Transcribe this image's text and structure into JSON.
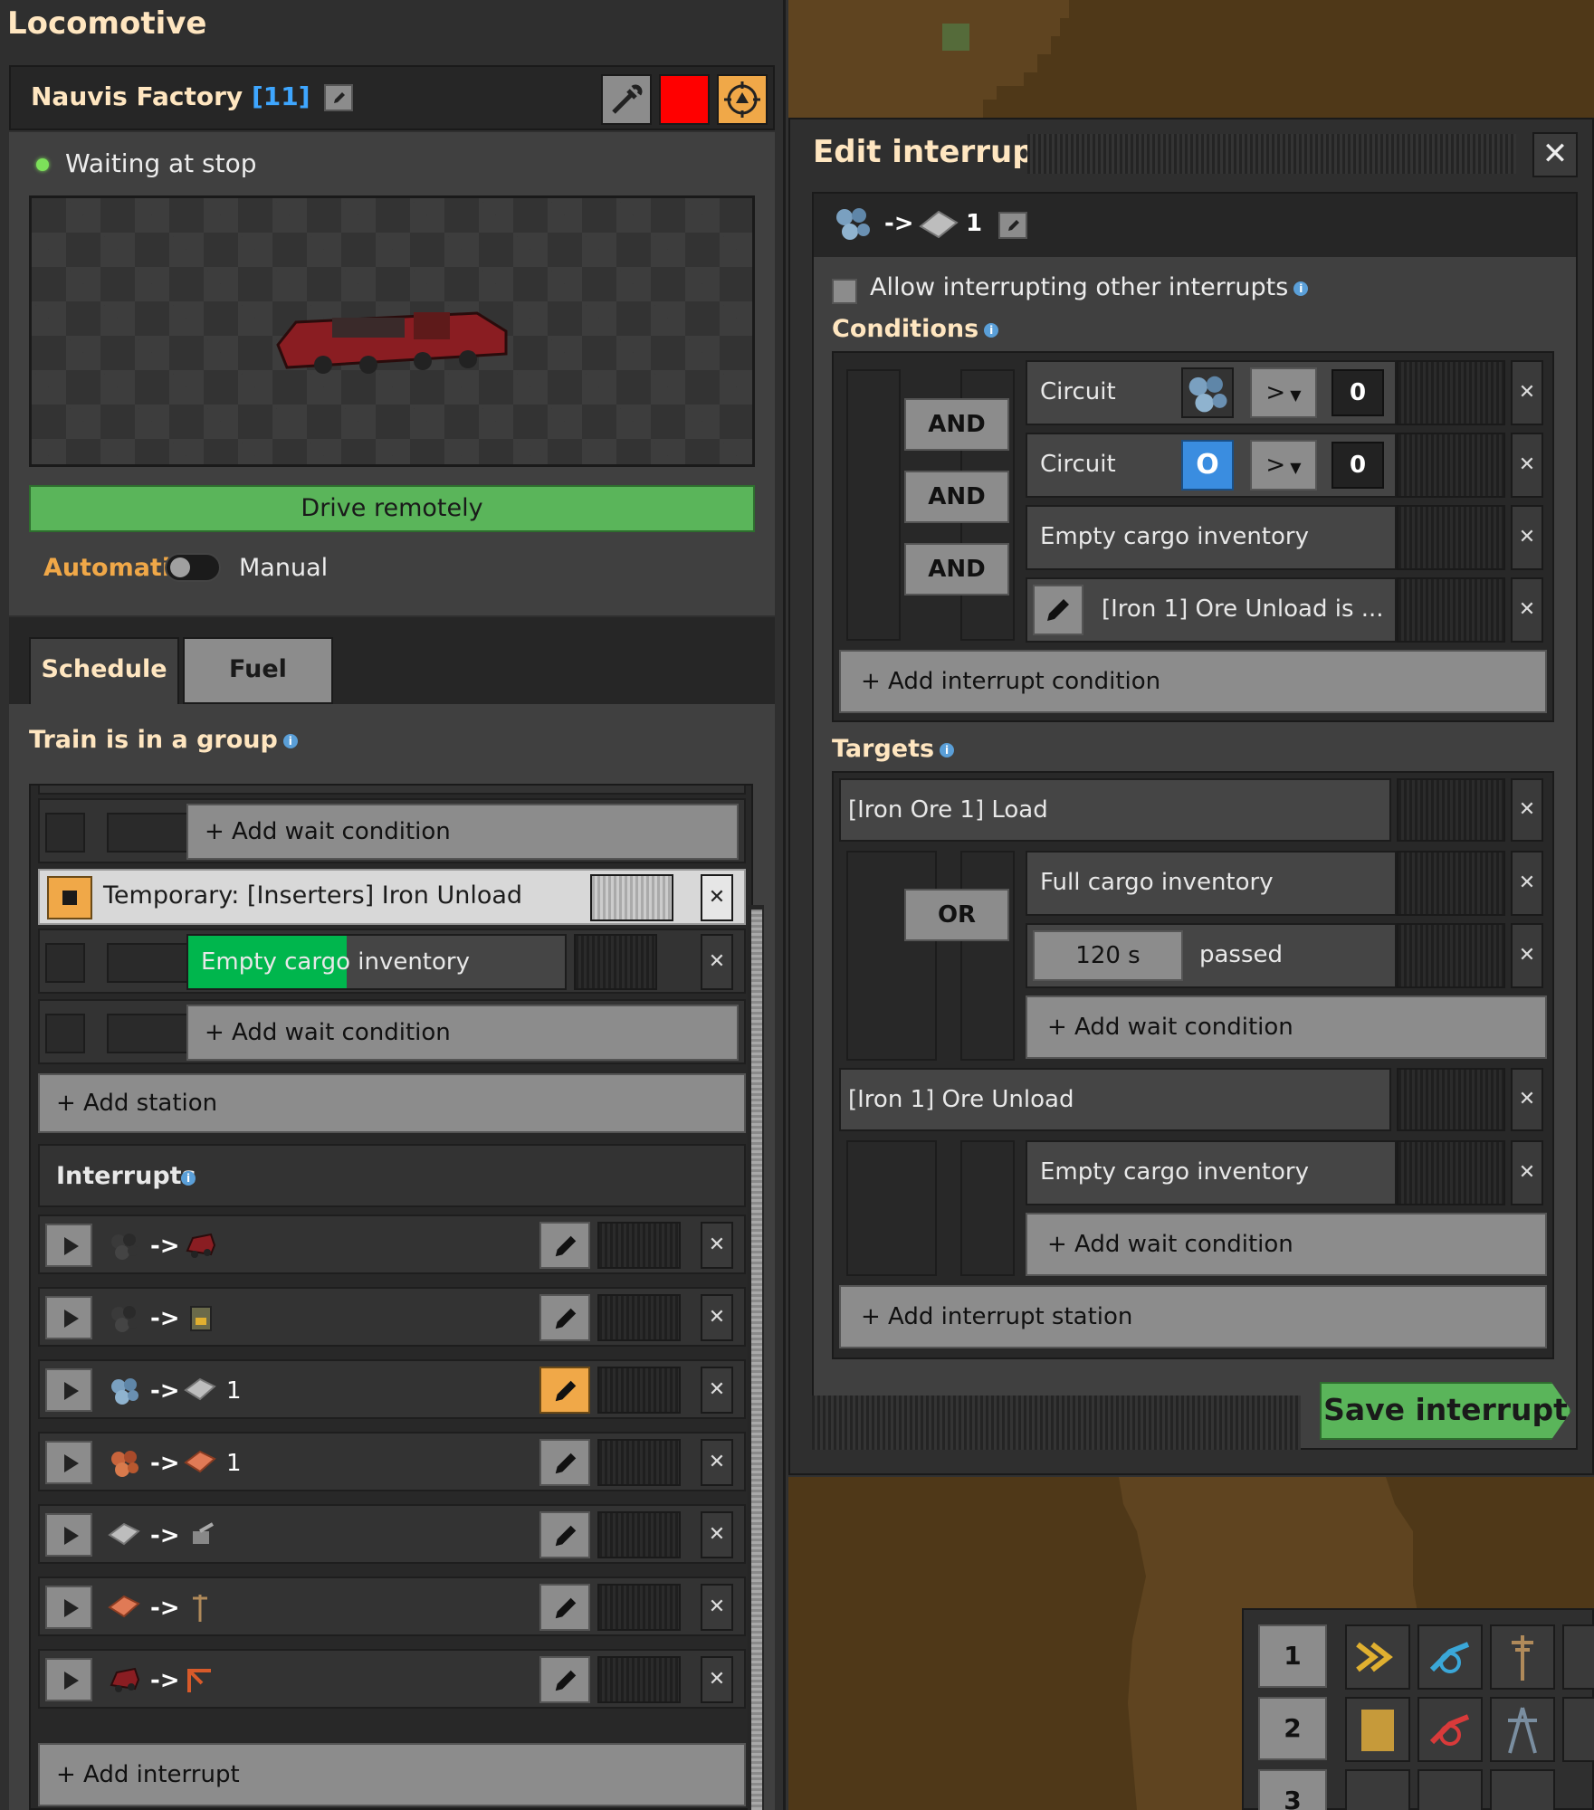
{
  "window_title": "Locomotive",
  "train": {
    "name": "Nauvis Factory",
    "count": "[11]"
  },
  "status": "Waiting at stop",
  "drive_remotely": "Drive remotely",
  "mode": {
    "automatic": "Automatic",
    "manual": "Manual"
  },
  "tabs": [
    "Schedule",
    "Fuel"
  ],
  "group_label": "Train is in a group",
  "schedule": {
    "add_wait_condition": "+ Add wait condition",
    "temp_station": "Temporary: [Inserters] Iron Unload",
    "temp_condition": "Empty cargo inventory",
    "temp_condition_progress": 0.42,
    "add_wait_condition_2": "+ Add wait condition",
    "add_station": "+ Add station",
    "interrupts_label": "Interrupts",
    "interrupts": [
      {
        "arrow": "->",
        "num": "",
        "from_icon": "coal-icon",
        "to_icon": "locomotive-icon"
      },
      {
        "arrow": "->",
        "num": "",
        "from_icon": "coal-icon",
        "to_icon": "furnace-icon"
      },
      {
        "arrow": "->",
        "num": "1",
        "from_icon": "iron-ore-icon",
        "to_icon": "iron-plate-icon"
      },
      {
        "arrow": "->",
        "num": "1",
        "from_icon": "copper-ore-icon",
        "to_icon": "copper-plate-icon"
      },
      {
        "arrow": "->",
        "num": "",
        "from_icon": "iron-plate-icon",
        "to_icon": "gun-turret-icon"
      },
      {
        "arrow": "->",
        "num": "",
        "from_icon": "copper-plate-icon",
        "to_icon": "medium-pole-icon"
      },
      {
        "arrow": "->",
        "num": "",
        "from_icon": "locomotive-icon",
        "to_icon": "cargo-crane-icon"
      }
    ],
    "add_interrupt": "+ Add interrupt"
  },
  "edit": {
    "title": "Edit interrupt",
    "close": "✕",
    "interrupt_name": {
      "arrow": "->",
      "num": "1"
    },
    "allow_label": "Allow interrupting other interrupts",
    "conditions_label": "Conditions",
    "conditions": [
      {
        "text": "Circuit",
        "signal": "iron-ore",
        "op": ">",
        "value": "0"
      },
      {
        "text": "Circuit",
        "signal": "O",
        "op": ">",
        "value": "0"
      },
      {
        "text": "Empty cargo inventory"
      },
      {
        "text": "[Iron 1] Ore Unload is ..."
      }
    ],
    "and_labels": [
      "AND",
      "AND",
      "AND"
    ],
    "add_interrupt_condition": "+ Add interrupt condition",
    "targets_label": "Targets",
    "targets": {
      "t1_name": "[Iron Ore 1] Load",
      "t1_cond1": "Full cargo inventory",
      "or_label": "OR",
      "t1_time": "120 s",
      "t1_passed": "passed",
      "t1_add": "+ Add wait condition",
      "t2_name": "[Iron 1] Ore Unload",
      "t2_cond1": "Empty cargo inventory",
      "t2_add": "+ Add wait condition"
    },
    "add_interrupt_station": "+ Add interrupt station",
    "save": "Save interrupt"
  },
  "quickbar": [
    "1",
    "2",
    "3"
  ],
  "colors": {
    "accent": "#f0a848",
    "green": "#5ab55a",
    "progress": "#00b64d",
    "title": "#ffe6c0",
    "link_blue": "#3ea6ff",
    "train_color": "#ff0000"
  }
}
